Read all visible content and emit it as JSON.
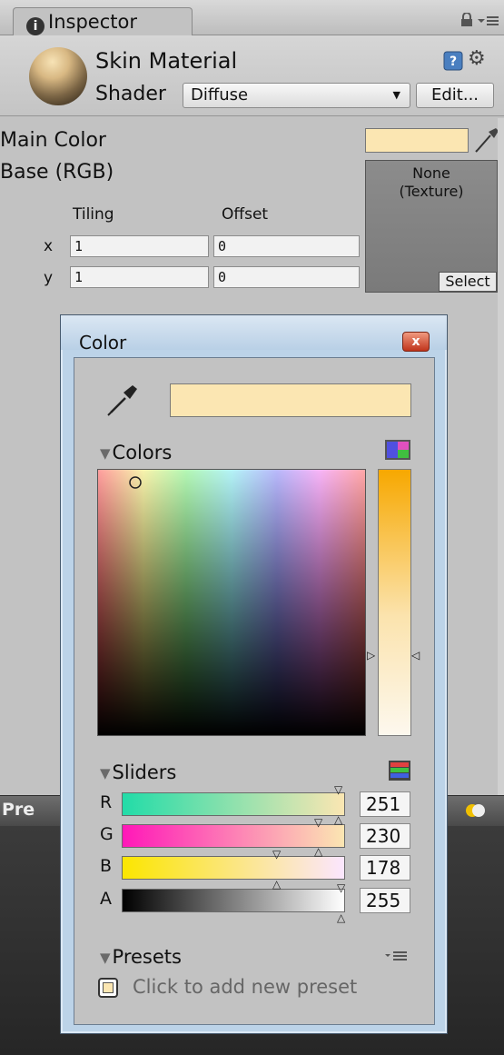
{
  "inspector": {
    "tab_label": "Inspector",
    "material_name": "Skin Material",
    "shader_label": "Shader",
    "shader_value": "Diffuse",
    "edit_button": "Edit...",
    "main_color_label": "Main Color",
    "main_color_hex": "#fbe6b2",
    "base_label": "Base (RGB)",
    "tiling_label": "Tiling",
    "offset_label": "Offset",
    "x_label": "x",
    "y_label": "y",
    "tiling_x": "1",
    "tiling_y": "1",
    "offset_x": "0",
    "offset_y": "0",
    "texture_none": "None",
    "texture_type": "(Texture)",
    "texture_select": "Select",
    "preview_label": "Pre"
  },
  "color_picker": {
    "title": "Color",
    "close_symbol": "x",
    "colors_section": "Colors",
    "sliders_section": "Sliders",
    "presets_section": "Presets",
    "channels": [
      {
        "label": "R",
        "value": "251"
      },
      {
        "label": "G",
        "value": "230"
      },
      {
        "label": "B",
        "value": "178"
      },
      {
        "label": "A",
        "value": "255"
      }
    ],
    "add_preset_text": "Click to add new preset",
    "current_color": "#fbe6b2"
  },
  "icons": [
    "info-icon",
    "lock-icon",
    "menu-icon",
    "help-icon",
    "gear-icon",
    "dropdown-arrow-icon",
    "eyedropper-icon",
    "close-icon",
    "color-mode-icon",
    "slider-mode-icon",
    "preset-menu-icon",
    "preset-add-icon"
  ]
}
